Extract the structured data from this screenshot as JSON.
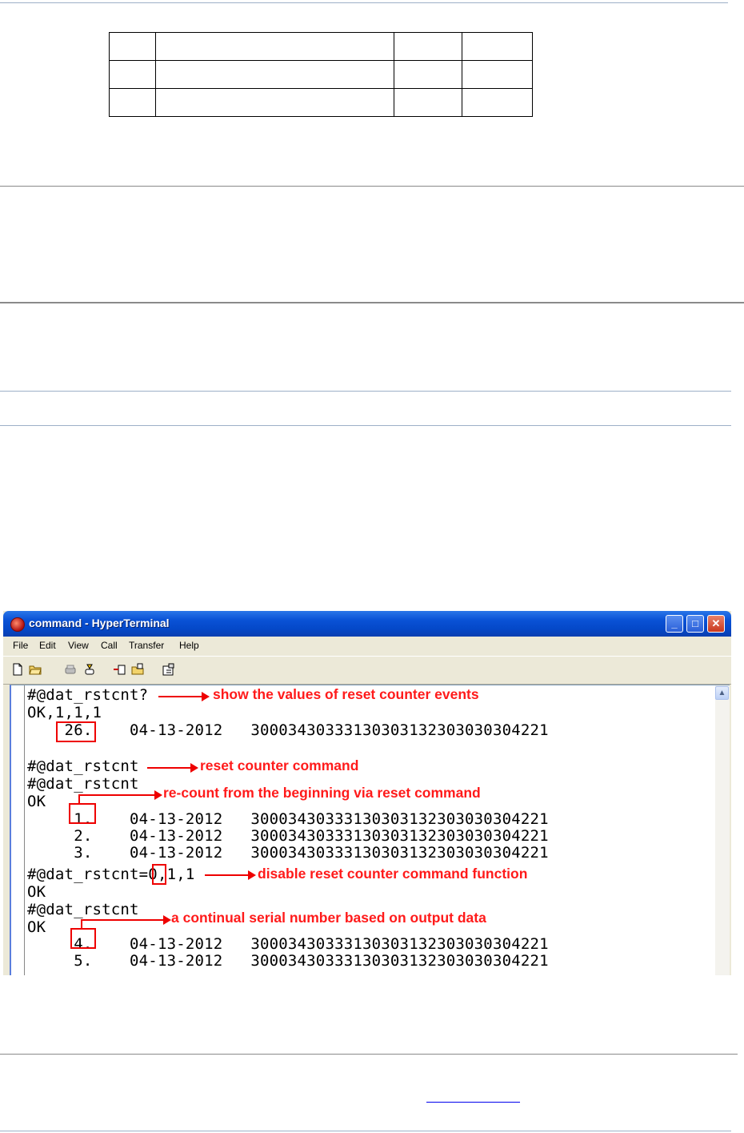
{
  "window": {
    "title": "command - HyperTerminal",
    "minimize_glyph": "_",
    "maximize_glyph": "□",
    "close_glyph": "✕"
  },
  "menu": [
    "File",
    "Edit",
    "View",
    "Call",
    "Transfer",
    "Help"
  ],
  "toolbar_icons": [
    "new-file-icon",
    "open-folder-icon",
    "disconnect-icon",
    "connect-icon",
    "send-icon",
    "receive-icon",
    "properties-icon"
  ],
  "terminal": {
    "lines": [
      "#@dat_rstcnt?",
      "OK,1,1,1",
      "    26.    04-13-2012   30003430333130303132303030304221",
      "",
      "#@dat_rstcnt",
      "#@dat_rstcnt",
      "OK",
      "     1.    04-13-2012   30003430333130303132303030304221",
      "     2.    04-13-2012   30003430333130303132303030304221",
      "     3.    04-13-2012   30003430333130303132303030304221",
      "#@dat_rstcnt=0,1,1",
      "OK",
      "#@dat_rstcnt",
      "OK",
      "     4.    04-13-2012   30003430333130303132303030304221",
      "     5.    04-13-2012   30003430333130303132303030304221"
    ],
    "annotations": {
      "a1": "show the values of reset counter events",
      "a2": "reset counter command",
      "a3": "re-count from the beginning via reset command",
      "a4": "disable reset counter command function",
      "a5": "a continual serial number based on output data"
    }
  },
  "colors": {
    "annotation": "#ff1a1a",
    "titlebar": "#0a52d6",
    "separator_blue": "#9db0c8",
    "separator_gray": "#8a8a8a"
  }
}
